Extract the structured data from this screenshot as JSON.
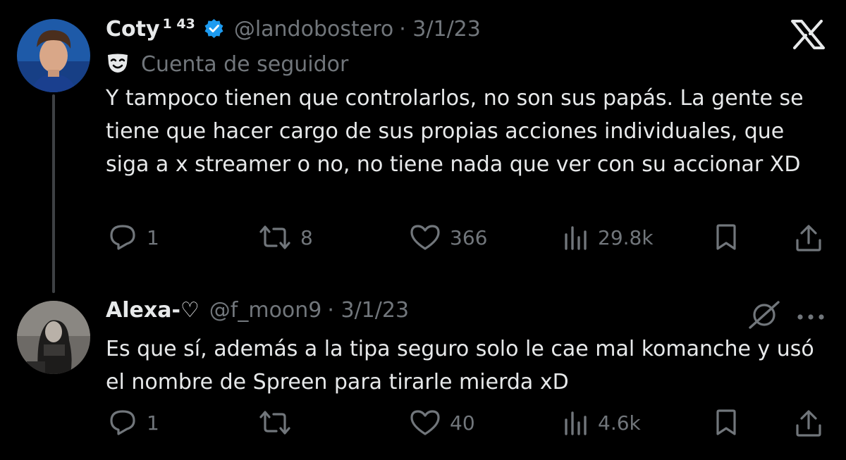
{
  "tweets": [
    {
      "display_name": "Coty",
      "badge": "1 43",
      "handle": "@landobostero",
      "date": "· 3/1/23",
      "account_label": "Cuenta de seguidor",
      "text": "Y tampoco tienen que controlarlos, no son sus papás. La gente se tiene que hacer cargo de sus propias acciones individuales, que siga a x streamer o no, no tiene nada que ver con su accionar XD",
      "replies": "1",
      "retweets": "8",
      "likes": "366",
      "views": "29.8k"
    },
    {
      "display_name": "Alexa-♡",
      "handle": "@f_moon9",
      "date": "· 3/1/23",
      "text": "Es que sí, además a la tipa seguro solo le cae  mal komanche y usó el nombre de Spreen para tirarle mierda xD",
      "replies": "1",
      "retweets": "",
      "likes": "40",
      "views": "4.6k"
    }
  ],
  "icons": {
    "platform": "x-logo-icon",
    "verified": "verified-badge-icon",
    "account_label": "mask-icon",
    "reply": "reply-icon",
    "retweet": "retweet-icon",
    "like": "heart-icon",
    "views": "views-bar-icon",
    "bookmark": "bookmark-icon",
    "share": "share-icon",
    "grok": "grok-icon",
    "more": "more-icon"
  },
  "colors": {
    "background": "#000000",
    "text": "#e7e9ea",
    "secondary": "#71767b",
    "verified": "#1d9bf0",
    "thread_line": "#3e4144"
  }
}
